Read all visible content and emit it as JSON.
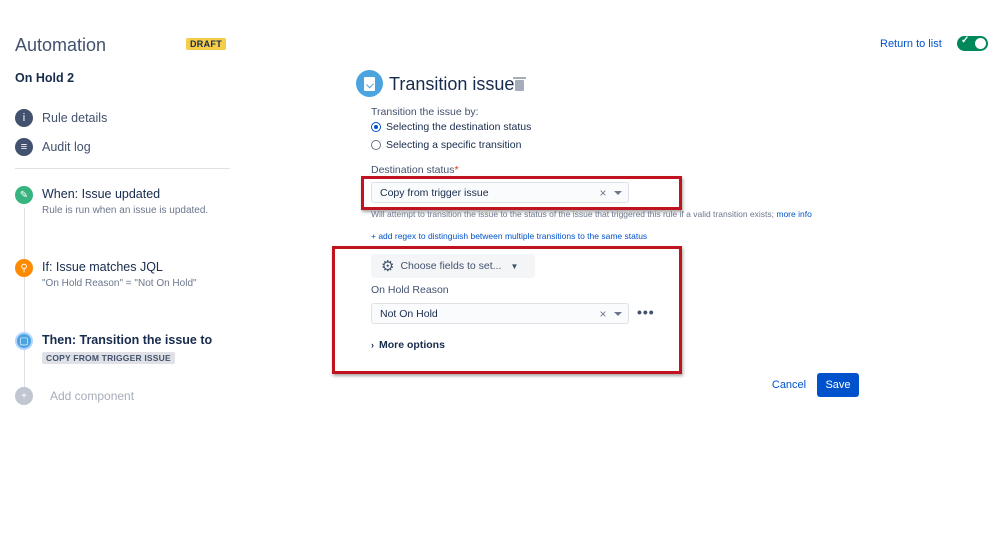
{
  "header": {
    "app_title": "Automation",
    "draft_badge": "DRAFT",
    "rule_name": "On Hold 2",
    "return_link": "Return to list",
    "toggle_enabled": true
  },
  "sidebar": {
    "nav": [
      {
        "label": "Rule details",
        "icon": "info-icon"
      },
      {
        "label": "Audit log",
        "icon": "log-icon"
      }
    ],
    "steps": [
      {
        "title": "When: Issue updated",
        "subtitle": "Rule is run when an issue is updated.",
        "icon": "pencil-icon",
        "color": "#36b37e"
      },
      {
        "title": "If: Issue matches JQL",
        "subtitle": "\"On Hold Reason\" = \"Not On Hold\"",
        "icon": "search-icon",
        "color": "#ff8b00"
      },
      {
        "title": "Then: Transition the issue to",
        "badge": "COPY FROM TRIGGER ISSUE",
        "icon": "transition-icon",
        "color": "#4ba4e0"
      }
    ],
    "add_component": "Add component"
  },
  "panel": {
    "title": "Transition issue",
    "transition_by_label": "Transition the issue by:",
    "radio_options": [
      {
        "label": "Selecting the destination status",
        "selected": true
      },
      {
        "label": "Selecting a specific transition",
        "selected": false
      }
    ],
    "destination_label": "Destination status",
    "required_mark": "*",
    "destination_value": "Copy from trigger issue",
    "helper_text": "Will attempt to transition the issue to the status of the issue that triggered this rule if a valid transition exists;",
    "helper_link": "more info",
    "regex_link": "+ add regex to distinguish between multiple transitions to the same status",
    "choose_fields": "Choose fields to set...",
    "on_hold_label": "On Hold Reason",
    "on_hold_value": "Not On Hold",
    "more_dots": "•••",
    "more_options": "More options",
    "cancel": "Cancel",
    "save": "Save"
  },
  "colors": {
    "accent": "#0052cc",
    "highlight": "#c1121f",
    "toggle_on": "#00875a"
  }
}
